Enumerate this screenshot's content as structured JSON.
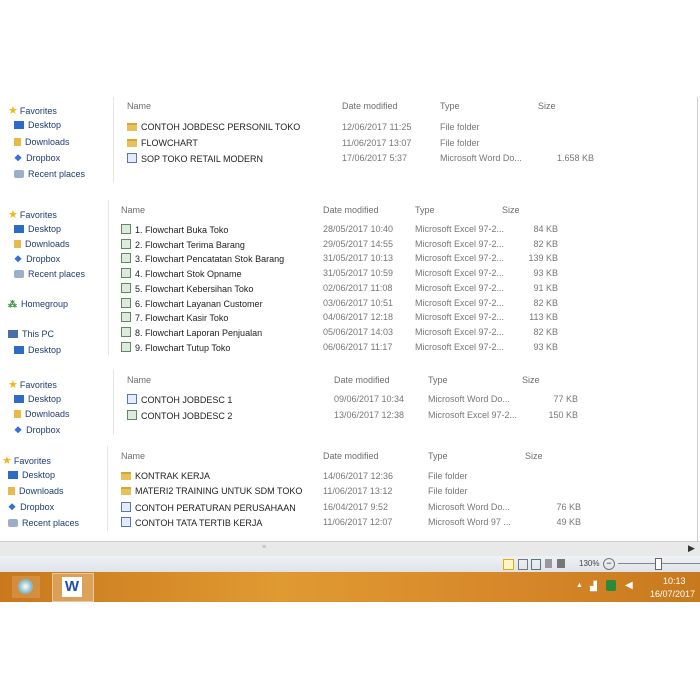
{
  "columns": {
    "name": "Name",
    "date": "Date modified",
    "type": "Type",
    "size": "Size"
  },
  "panels": [
    {
      "nav": [
        {
          "label": "Favorites",
          "icon": "star-icon"
        },
        {
          "label": "Desktop",
          "icon": "desktop-icon"
        },
        {
          "label": "Downloads",
          "icon": "downloads-icon"
        },
        {
          "label": "Dropbox",
          "icon": "dropbox-icon"
        },
        {
          "label": "Recent places",
          "icon": "recent-places-icon"
        }
      ],
      "files": [
        {
          "name": "CONTOH JOBDESC PERSONIL TOKO",
          "date": "12/06/2017 11:25",
          "type": "File folder",
          "size": "",
          "icon": "folder-icon"
        },
        {
          "name": "FLOWCHART",
          "date": "11/06/2017 13:07",
          "type": "File folder",
          "size": "",
          "icon": "folder-icon"
        },
        {
          "name": "SOP TOKO RETAIL MODERN",
          "date": "17/06/2017 5:37",
          "type": "Microsoft Word Do...",
          "size": "1.658 KB",
          "icon": "word-doc-icon"
        }
      ]
    },
    {
      "nav": [
        {
          "label": "Favorites",
          "icon": "star-icon"
        },
        {
          "label": "Desktop",
          "icon": "desktop-icon"
        },
        {
          "label": "Downloads",
          "icon": "downloads-icon"
        },
        {
          "label": "Dropbox",
          "icon": "dropbox-icon"
        },
        {
          "label": "Recent places",
          "icon": "recent-places-icon"
        },
        {
          "label": "Homegroup",
          "icon": "homegroup-icon"
        },
        {
          "label": "This PC",
          "icon": "this-pc-icon"
        },
        {
          "label": "Desktop",
          "icon": "desktop-icon"
        }
      ],
      "files": [
        {
          "name": "1. Flowchart Buka Toko",
          "date": "28/05/2017 10:40",
          "type": "Microsoft Excel 97-2...",
          "size": "84 KB",
          "icon": "excel-icon"
        },
        {
          "name": "2. Flowchart Terima Barang",
          "date": "29/05/2017 14:55",
          "type": "Microsoft Excel 97-2...",
          "size": "82 KB",
          "icon": "excel-icon"
        },
        {
          "name": "3. Flowchart Pencatatan Stok Barang",
          "date": "31/05/2017 10:13",
          "type": "Microsoft Excel 97-2...",
          "size": "139 KB",
          "icon": "excel-icon"
        },
        {
          "name": "4. Flowchart Stok Opname",
          "date": "31/05/2017 10:59",
          "type": "Microsoft Excel 97-2...",
          "size": "93 KB",
          "icon": "excel-icon"
        },
        {
          "name": "5. Flowchart Kebersihan Toko",
          "date": "02/06/2017 11:08",
          "type": "Microsoft Excel 97-2...",
          "size": "91 KB",
          "icon": "excel-icon"
        },
        {
          "name": "6. Flowchart Layanan Customer",
          "date": "03/06/2017 10:51",
          "type": "Microsoft Excel 97-2...",
          "size": "82 KB",
          "icon": "excel-icon"
        },
        {
          "name": "7. Flowchart Kasir Toko",
          "date": "04/06/2017 12:18",
          "type": "Microsoft Excel 97-2...",
          "size": "113 KB",
          "icon": "excel-icon"
        },
        {
          "name": "8. Flowchart Laporan Penjualan",
          "date": "05/06/2017 14:03",
          "type": "Microsoft Excel 97-2...",
          "size": "82 KB",
          "icon": "excel-icon"
        },
        {
          "name": "9. Flowchart Tutup Toko",
          "date": "06/06/2017 11:17",
          "type": "Microsoft Excel 97-2...",
          "size": "93 KB",
          "icon": "excel-icon"
        }
      ]
    },
    {
      "nav": [
        {
          "label": "Favorites",
          "icon": "star-icon"
        },
        {
          "label": "Desktop",
          "icon": "desktop-icon"
        },
        {
          "label": "Downloads",
          "icon": "downloads-icon"
        },
        {
          "label": "Dropbox",
          "icon": "dropbox-icon"
        }
      ],
      "files": [
        {
          "name": "CONTOH JOBDESC 1",
          "date": "09/06/2017 10:34",
          "type": "Microsoft Word Do...",
          "size": "77 KB",
          "icon": "word-doc-icon"
        },
        {
          "name": "CONTOH JOBDESC 2",
          "date": "13/06/2017 12:38",
          "type": "Microsoft Excel 97-2...",
          "size": "150 KB",
          "icon": "excel-icon"
        }
      ]
    },
    {
      "nav": [
        {
          "label": "Favorites",
          "icon": "star-icon"
        },
        {
          "label": "Desktop",
          "icon": "desktop-icon"
        },
        {
          "label": "Downloads",
          "icon": "downloads-icon"
        },
        {
          "label": "Dropbox",
          "icon": "dropbox-icon"
        },
        {
          "label": "Recent places",
          "icon": "recent-places-icon"
        }
      ],
      "files": [
        {
          "name": "KONTRAK KERJA",
          "date": "14/06/2017 12:36",
          "type": "File folder",
          "size": "",
          "icon": "folder-icon"
        },
        {
          "name": "MATERI2 TRAINING UNTUK SDM TOKO",
          "date": "11/06/2017 13:12",
          "type": "File folder",
          "size": "",
          "icon": "folder-icon"
        },
        {
          "name": "CONTOH PERATURAN PERUSAHAAN",
          "date": "16/04/2017 9:52",
          "type": "Microsoft Word Do...",
          "size": "76 KB",
          "icon": "word-doc-icon"
        },
        {
          "name": "CONTOH TATA TERTIB KERJA",
          "date": "11/06/2017 12:07",
          "type": "Microsoft Word 97 ...",
          "size": "49 KB",
          "icon": "word-doc-icon"
        }
      ]
    }
  ],
  "statusbar": {
    "zoom": "130%"
  },
  "taskbar": {
    "time": "10:13",
    "date": "16/07/2017",
    "apps": [
      "paint-icon",
      "word-icon"
    ]
  }
}
